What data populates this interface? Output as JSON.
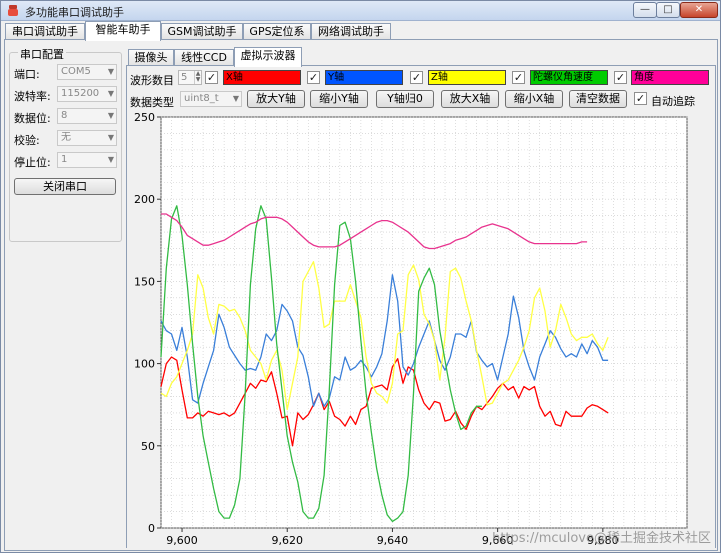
{
  "window": {
    "title": "多功能串口调试助手",
    "min": "—",
    "max": "□",
    "close": "✕"
  },
  "main_tabs": [
    "串口调试助手",
    "智能车助手",
    "GSM调试助手",
    "GPS定位系统",
    "网络调试助手"
  ],
  "serial_config": {
    "group_title": "串口配置",
    "port_label": "端口:",
    "port_value": "COM5",
    "baud_label": "波特率:",
    "baud_value": "115200",
    "databits_label": "数据位:",
    "databits_value": "8",
    "parity_label": "校验:",
    "parity_value": "无",
    "stopbits_label": "停止位:",
    "stopbits_value": "1",
    "close_button": "关闭串口"
  },
  "sub_tabs": [
    "摄像头",
    "线性CCD",
    "虚拟示波器"
  ],
  "controls": {
    "wave_count_label": "波形数目",
    "wave_count_value": "5",
    "data_type_label": "数据类型",
    "data_type_value": "uint8_t",
    "buttons": [
      "放大Y轴",
      "缩小Y轴",
      "Y轴归0",
      "放大X轴",
      "缩小X轴",
      "清空数据"
    ],
    "auto_track_label": "自动追踪",
    "channels": [
      {
        "label": "X轴",
        "color": "#ff0000",
        "text_color": "#000000",
        "checked": true
      },
      {
        "label": "Y轴",
        "color": "#0055ff",
        "text_color": "#000000",
        "checked": true
      },
      {
        "label": "Z轴",
        "color": "#ffff00",
        "text_color": "#000000",
        "checked": true
      },
      {
        "label": "陀螺仪角速度",
        "color": "#00cc00",
        "text_color": "#000000",
        "checked": true
      },
      {
        "label": "角度",
        "color": "#ff0099",
        "text_color": "#000000",
        "checked": true
      }
    ]
  },
  "watermark": "https://mculove@稀土掘金技术社区",
  "chart_data": {
    "type": "line",
    "xlim": [
      9596,
      9696
    ],
    "ylim": [
      0,
      250
    ],
    "x_ticks": [
      9600,
      9620,
      9640,
      9660,
      9680
    ],
    "x_tick_labels": [
      "9,600",
      "9,620",
      "9,640",
      "9,660",
      "9,680"
    ],
    "y_ticks": [
      0,
      50,
      100,
      150,
      200,
      250
    ],
    "y_tick_labels": [
      "0",
      "50",
      "100",
      "150",
      "200",
      "250"
    ],
    "grid": true,
    "x_start": 9596,
    "x_step": 1,
    "series": [
      {
        "name": "X轴",
        "color": "#ff0000",
        "values": [
          86,
          100,
          104,
          102,
          84,
          67,
          67,
          70,
          68,
          71,
          70,
          69,
          70,
          68,
          70,
          76,
          82,
          88,
          85,
          90,
          89,
          95,
          82,
          67,
          68,
          50,
          70,
          66,
          69,
          75,
          82,
          72,
          77,
          68,
          66,
          62,
          68,
          63,
          72,
          74,
          85,
          86,
          87,
          84,
          98,
          103,
          88,
          98,
          96,
          84,
          76,
          72,
          77,
          76,
          65,
          66,
          71,
          64,
          60,
          68,
          74,
          72,
          76,
          80,
          85,
          88,
          84,
          86,
          79,
          86,
          84,
          86,
          74,
          68,
          71,
          63,
          62,
          71,
          68,
          68,
          68,
          73,
          75,
          74,
          72,
          70
        ]
      },
      {
        "name": "Y轴",
        "color": "#3a7fd9",
        "values": [
          126,
          120,
          118,
          108,
          122,
          104,
          78,
          76,
          88,
          98,
          108,
          130,
          122,
          110,
          105,
          100,
          96,
          97,
          96,
          104,
          118,
          114,
          120,
          136,
          132,
          126,
          110,
          105,
          92,
          74,
          82,
          74,
          79,
          92,
          90,
          104,
          96,
          98,
          102,
          98,
          92,
          98,
          106,
          126,
          154,
          138,
          98,
          93,
          100,
          110,
          118,
          126,
          114,
          102,
          96,
          104,
          118,
          118,
          116,
          126,
          107,
          102,
          98,
          100,
          90,
          104,
          118,
          141,
          128,
          108,
          98,
          90,
          104,
          112,
          120,
          116,
          109,
          104,
          106,
          104,
          112,
          106,
          114,
          110,
          102,
          102
        ]
      },
      {
        "name": "Z轴",
        "color": "#ffff44",
        "values": [
          82,
          80,
          88,
          92,
          100,
          108,
          118,
          154,
          146,
          128,
          118,
          136,
          135,
          132,
          133,
          128,
          120,
          108,
          104,
          100,
          90,
          102,
          108,
          96,
          72,
          88,
          104,
          150,
          156,
          162,
          146,
          122,
          124,
          138,
          138,
          138,
          148,
          138,
          128,
          104,
          88,
          82,
          80,
          76,
          88,
          118,
          120,
          154,
          160,
          151,
          130,
          124,
          114,
          90,
          116,
          156,
          158,
          152,
          138,
          126,
          108,
          92,
          75,
          76,
          82,
          88,
          90,
          96,
          102,
          110,
          120,
          140,
          146,
          132,
          110,
          120,
          136,
          128,
          118,
          114,
          116,
          116,
          118,
          112,
          108,
          116
        ]
      },
      {
        "name": "陀螺仪角速度",
        "color": "#33bb44",
        "values": [
          104,
          158,
          188,
          196,
          178,
          148,
          112,
          80,
          56,
          40,
          24,
          10,
          6,
          6,
          14,
          30,
          82,
          148,
          182,
          196,
          188,
          152,
          112,
          84,
          56,
          40,
          28,
          10,
          6,
          6,
          12,
          32,
          84,
          148,
          184,
          186,
          176,
          150,
          114,
          82,
          58,
          36,
          20,
          8,
          4,
          6,
          10,
          32,
          82,
          144,
          152,
          158,
          148,
          120,
          102,
          84,
          70,
          60,
          62,
          70,
          74,
          74
        ]
      },
      {
        "name": "角度",
        "color": "#e8338e",
        "values": [
          191,
          191,
          189,
          187,
          183,
          178,
          176,
          174,
          172,
          172,
          173,
          174,
          175,
          177,
          179,
          181,
          183,
          185,
          186,
          188,
          189,
          189,
          189,
          188,
          186,
          183,
          180,
          177,
          174,
          172,
          171,
          171,
          171,
          171,
          172,
          174,
          176,
          178,
          180,
          182,
          184,
          186,
          187,
          187,
          186,
          184,
          182,
          180,
          177,
          174,
          171,
          170,
          170,
          171,
          172,
          173,
          175,
          176,
          177,
          179,
          181,
          183,
          184,
          185,
          184,
          183,
          182,
          180,
          178,
          176,
          174,
          173,
          173,
          173,
          173,
          173,
          173,
          173,
          173,
          173,
          174,
          174
        ]
      }
    ]
  }
}
